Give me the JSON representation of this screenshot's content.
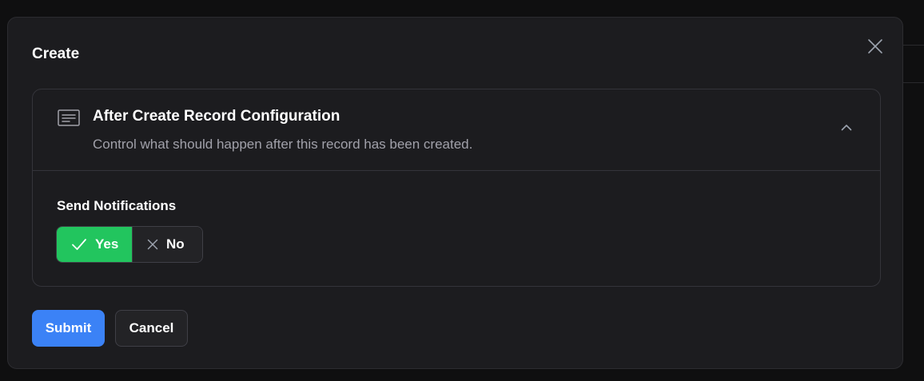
{
  "modal": {
    "title": "Create",
    "close_icon": "close-icon"
  },
  "section": {
    "icon": "document-text-icon",
    "title": "After Create Record Configuration",
    "description": "Control what should happen after this record has been created.",
    "collapse_icon": "chevron-up-icon",
    "expanded": true
  },
  "field": {
    "label": "Send Notifications",
    "options": [
      {
        "label": "Yes",
        "icon": "check-icon",
        "selected": true
      },
      {
        "label": "No",
        "icon": "x-icon",
        "selected": false
      }
    ]
  },
  "actions": {
    "submit_label": "Submit",
    "cancel_label": "Cancel"
  },
  "colors": {
    "selected": "#22c55e",
    "primary": "#3b82f6",
    "surface": "#1c1c1f"
  }
}
